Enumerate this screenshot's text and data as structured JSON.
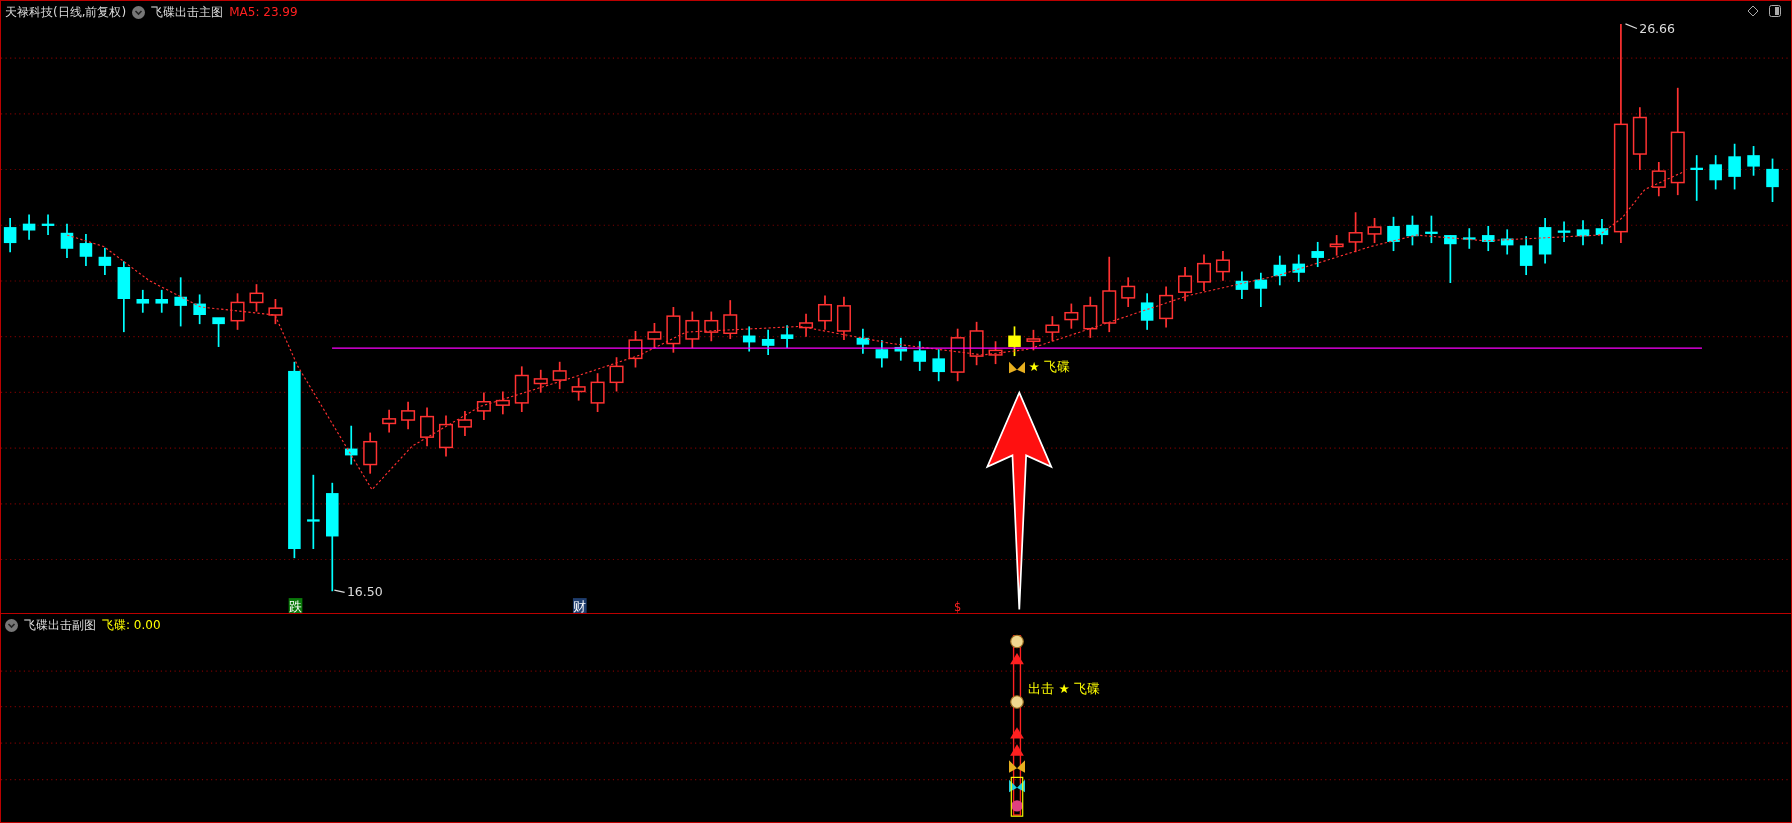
{
  "main_panel": {
    "stock_title": "天禄科技(日线,前复权)",
    "indicator_name": "飞碟出击主图",
    "ma_reading": "MA5: 23.99",
    "high_label": "26.66",
    "low_label": "16.50",
    "signal_label": "★ 飞碟",
    "markers": [
      {
        "text": "跌",
        "kind": "box",
        "color": "#0a7a0a"
      },
      {
        "text": "财",
        "kind": "box",
        "color": "#1f3d6e"
      },
      {
        "text": "$",
        "kind": "plain",
        "color": "#ff2020"
      }
    ]
  },
  "sub_panel": {
    "indicator_name": "飞碟出击副图",
    "reading": "飞碟: 0.00",
    "signal_label": "出击 ★ 飞碟"
  }
}
